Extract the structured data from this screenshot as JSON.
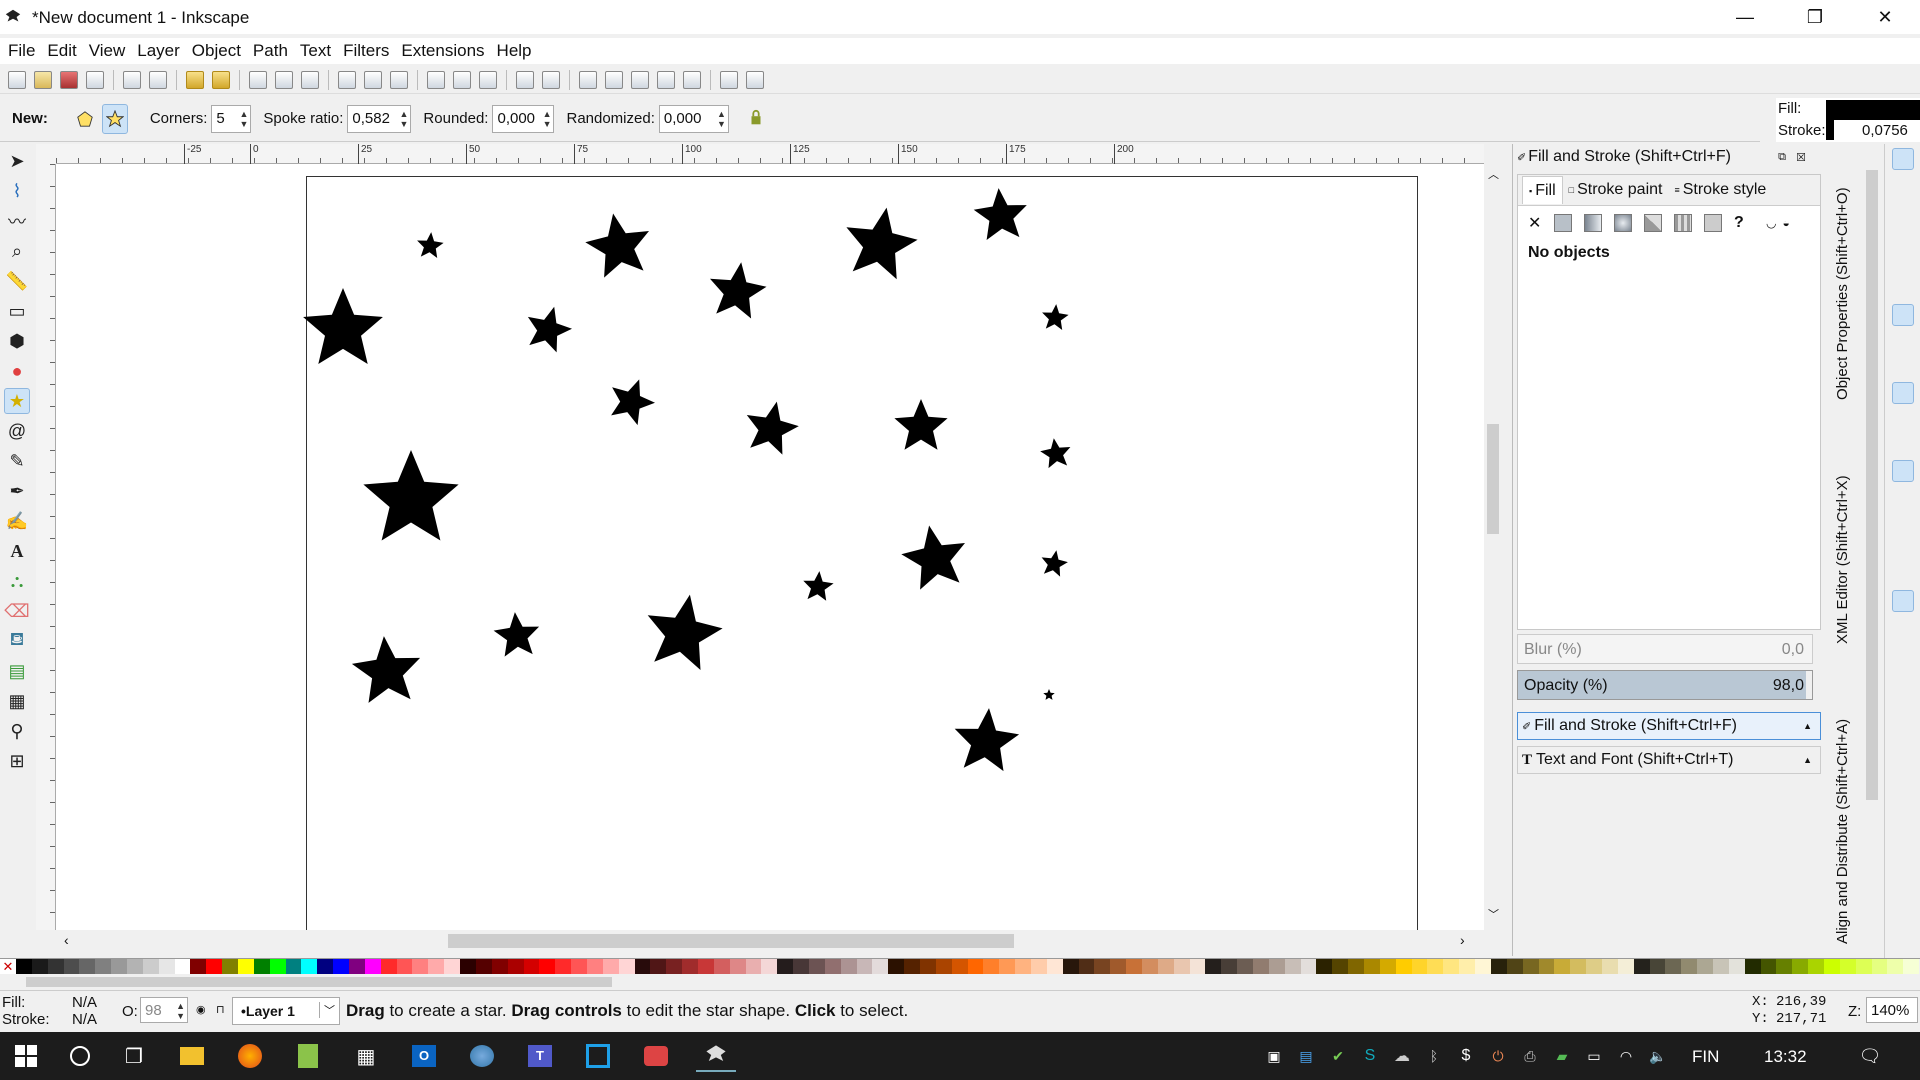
{
  "window": {
    "title": "*New document 1 - Inkscape",
    "minimize": "—",
    "maximize": "❐",
    "close": "✕"
  },
  "menu": [
    "File",
    "Edit",
    "View",
    "Layer",
    "Object",
    "Path",
    "Text",
    "Filters",
    "Extensions",
    "Help"
  ],
  "toolcontrols": {
    "new_label": "New:",
    "corners_label": "Corners:",
    "corners_value": "5",
    "spoke_label": "Spoke ratio:",
    "spoke_value": "0,582",
    "rounded_label": "Rounded:",
    "rounded_value": "0,000",
    "randomized_label": "Randomized:",
    "randomized_value": "0,000"
  },
  "indicator": {
    "fill_label": "Fill:",
    "stroke_label": "Stroke:",
    "stroke_value": "0,0756",
    "fill_color": "#000000"
  },
  "ruler_labels": [
    "-25",
    "0",
    "25",
    "50",
    "75",
    "100",
    "125",
    "150",
    "175",
    "200"
  ],
  "dock": {
    "panel_title": "Fill and Stroke (Shift+Ctrl+F)",
    "tabs": [
      "Fill",
      "Stroke paint",
      "Stroke style"
    ],
    "no_objects": "No objects",
    "blur_label": "Blur (%)",
    "blur_value": "0,0",
    "opacity_label": "Opacity (%)",
    "opacity_value": "98,0",
    "sections": [
      {
        "label": "Fill and Stroke (Shift+Ctrl+F)"
      },
      {
        "label": "Text and Font (Shift+Ctrl+T)"
      }
    ],
    "vertical_tabs": [
      "Object Properties (Shift+Ctrl+O)",
      "XML Editor (Shift+Ctrl+X)",
      "Align and Distribute (Shift+Ctrl+A)"
    ]
  },
  "status": {
    "fill_label": "Fill:",
    "fill_value": "N/A",
    "stroke_label": "Stroke:",
    "stroke_value": "N/A",
    "opacity_label": "O:",
    "opacity_value": "98",
    "layer": "•Layer 1",
    "msg_1": "Drag",
    "msg_2": " to create a star. ",
    "msg_3": "Drag controls",
    "msg_4": " to edit the star shape. ",
    "msg_5": "Click",
    "msg_6": " to select.",
    "x_label": "X:",
    "x_value": "216,39",
    "y_label": "Y:",
    "y_value": "217,71",
    "zoom_label": "Z:",
    "zoom_value": "140%"
  },
  "taskbar": {
    "lang": "FIN",
    "time": "13:32"
  },
  "palette": [
    "#000000",
    "#1a1a1a",
    "#333333",
    "#4d4d4d",
    "#666666",
    "#808080",
    "#999999",
    "#b3b3b3",
    "#cccccc",
    "#e6e6e6",
    "#ffffff",
    "#800000",
    "#ff0000",
    "#808000",
    "#ffff00",
    "#008000",
    "#00ff00",
    "#008080",
    "#00ffff",
    "#000080",
    "#0000ff",
    "#800080",
    "#ff00ff",
    "#ff2a2a",
    "#ff5555",
    "#ff8080",
    "#ffaaaa",
    "#ffd5d5",
    "#2b0000",
    "#550000",
    "#800000",
    "#aa0000",
    "#d40000",
    "#ff0000",
    "#ff2a2a",
    "#ff5555",
    "#ff8080",
    "#ffaaaa",
    "#ffd5d5",
    "#280b0b",
    "#501616",
    "#782121",
    "#a02c2c",
    "#c83737",
    "#d35f5f",
    "#de8787",
    "#e9afaf",
    "#f4d7d7",
    "#241c1c",
    "#483737",
    "#6c5353",
    "#916f6f",
    "#ac9393",
    "#c8b7b7",
    "#e3dbdb",
    "#2b1100",
    "#552200",
    "#803300",
    "#aa4400",
    "#d45500",
    "#ff6600",
    "#ff7f2a",
    "#ff9955",
    "#ffb380",
    "#ffccaa",
    "#ffe6d5",
    "#28170b",
    "#502d16",
    "#784421",
    "#a05a2c",
    "#c87137",
    "#d38d5f",
    "#deaa87",
    "#e9c6af",
    "#f4e3d7",
    "#241f1c",
    "#483e37",
    "#6c5d53",
    "#917c6f",
    "#ac9d93",
    "#c8beb7",
    "#e3dedb",
    "#2b2200",
    "#554400",
    "#806600",
    "#aa8800",
    "#d4aa00",
    "#ffcc00",
    "#ffd42a",
    "#ffdd55",
    "#ffe680",
    "#ffeeaa",
    "#fff6d5",
    "#28220b",
    "#504416",
    "#786721",
    "#a0892c",
    "#c8ab37",
    "#d3bc5f",
    "#decd87",
    "#e9ddaf",
    "#f4eed7",
    "#24221c",
    "#484537",
    "#6c6753",
    "#918a6f",
    "#aca793",
    "#c8c4b7",
    "#e3e2db",
    "#222b00",
    "#445500",
    "#668000",
    "#88aa00",
    "#aad400",
    "#ccff00",
    "#d4ff2a",
    "#ddff55",
    "#e5ff80",
    "#eeffaa",
    "#f6ffd5"
  ]
}
